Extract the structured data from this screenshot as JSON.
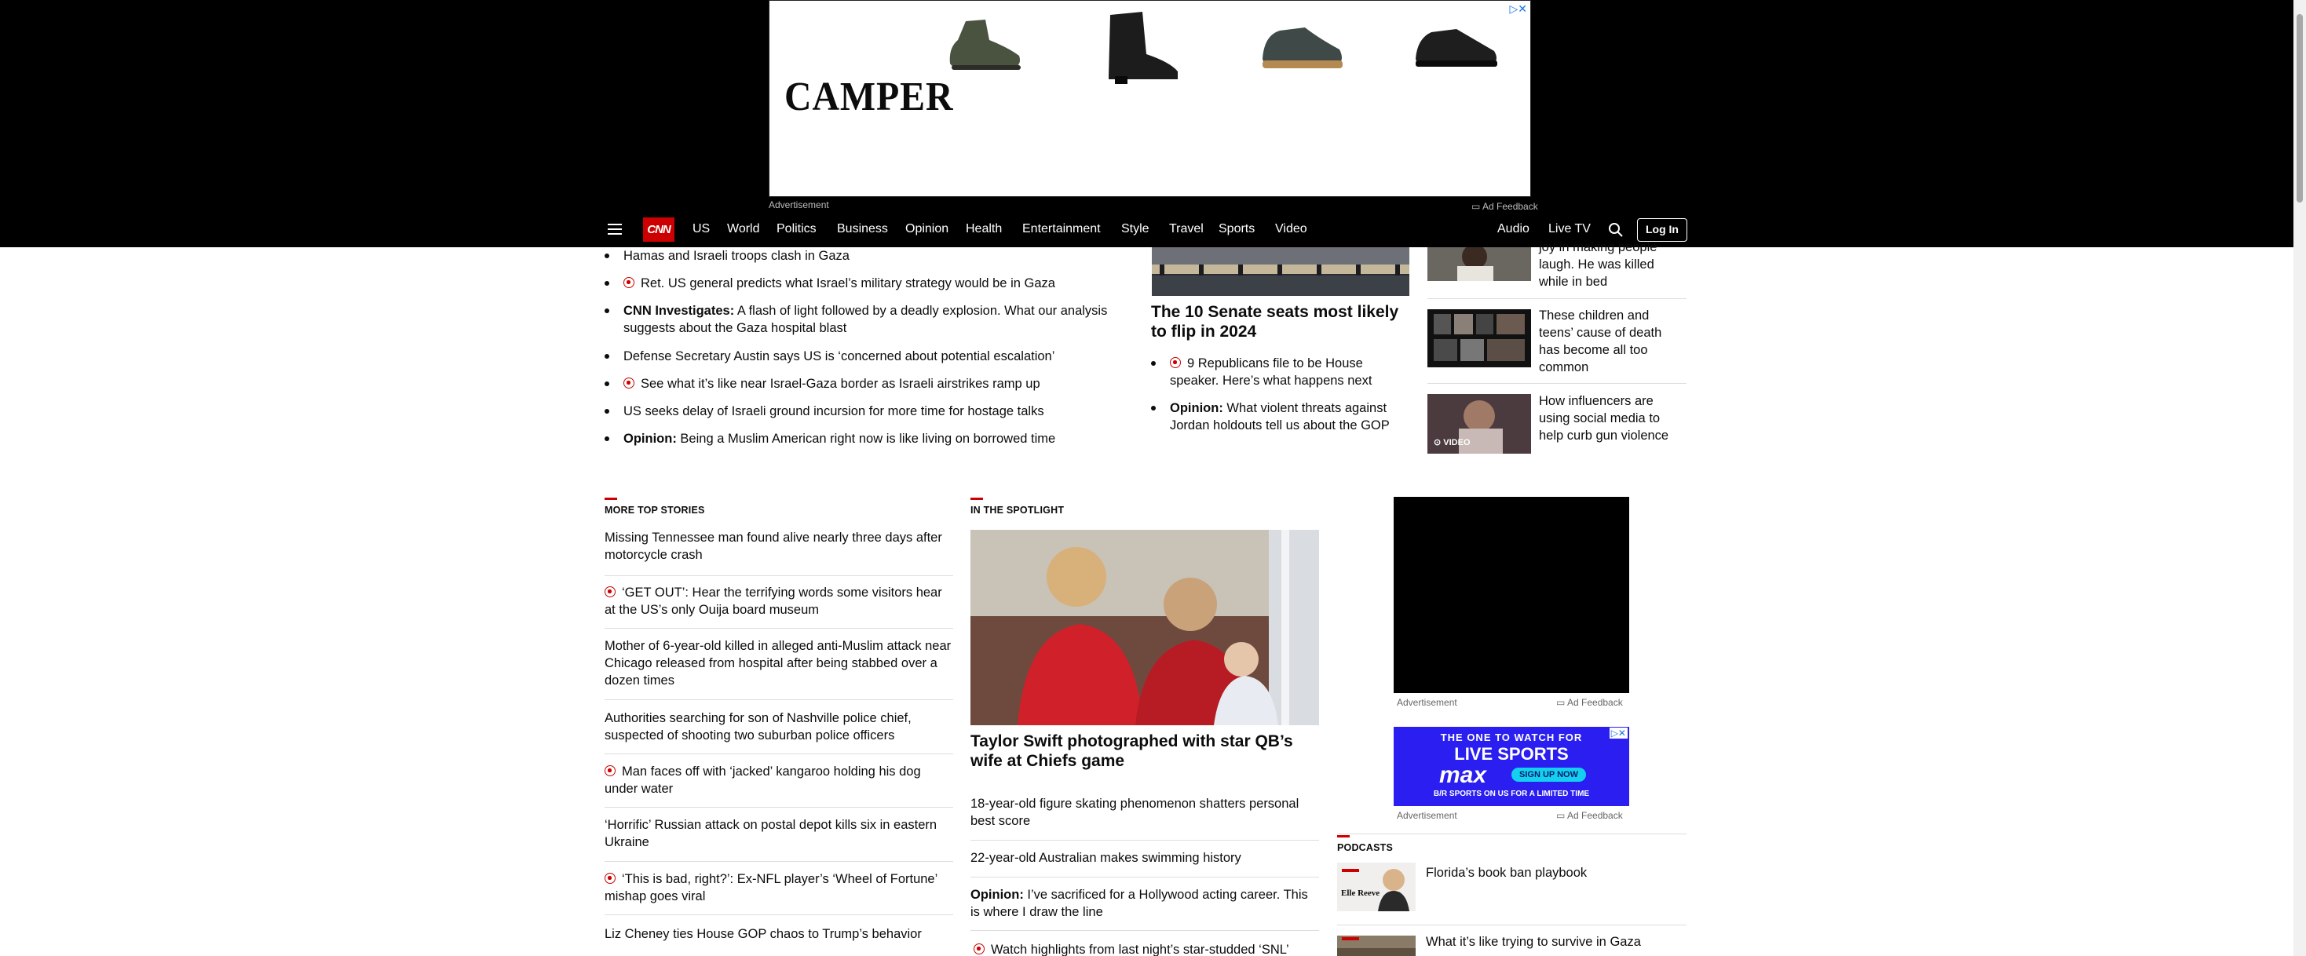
{
  "ad_top": {
    "brand": "CAMPER",
    "label": "Advertisement",
    "feedback": "Ad Feedback",
    "choices_icon": "adchoices-icon"
  },
  "nav": {
    "menu_icon": "hamburger-menu-icon",
    "logo": "CNN",
    "items": [
      "US",
      "World",
      "Politics",
      "Business",
      "Opinion",
      "Health",
      "Entertainment",
      "Style",
      "Travel",
      "Sports",
      "Video"
    ],
    "right_items": [
      "Audio",
      "Live TV"
    ],
    "search_icon": "search-icon",
    "login": "Log In"
  },
  "top_list": [
    {
      "prefix": "",
      "video": false,
      "text": "Hamas and Israeli troops clash in Gaza"
    },
    {
      "prefix": "",
      "video": true,
      "text": "Ret. US general predicts what Israel’s military strategy would be in Gaza"
    },
    {
      "prefix": "CNN Investigates:",
      "video": false,
      "text": "A flash of light followed by a deadly explosion. What our analysis suggests about the Gaza hospital blast"
    },
    {
      "prefix": "",
      "video": false,
      "text": "Defense Secretary Austin says US is ‘concerned about potential escalation’"
    },
    {
      "prefix": "",
      "video": true,
      "text": "See what it’s like near Israel-Gaza border as Israeli airstrikes ramp up"
    },
    {
      "prefix": "",
      "video": false,
      "text": "US seeks delay of Israeli ground incursion for more time for hostage talks"
    },
    {
      "prefix": "Opinion:",
      "video": false,
      "text": "Being a Muslim American right now is like living on borrowed time"
    }
  ],
  "middle": {
    "headline": "The 10 Senate seats most likely to flip in 2024",
    "bullets": [
      {
        "prefix": "",
        "video": true,
        "text": "9 Republicans file to be House speaker. Here’s what happens next"
      },
      {
        "prefix": "Opinion:",
        "video": false,
        "text": "What violent threats against Jordan holdouts tell us about the GOP"
      }
    ]
  },
  "right_stories": [
    {
      "text": "joy in making people laugh. He was killed while in bed",
      "badge": ""
    },
    {
      "text": "These children and teens’ cause of death has become all too common",
      "badge": ""
    },
    {
      "text": "How influencers are using social media to help curb gun violence",
      "badge": "VIDEO"
    }
  ],
  "more_top_stories": {
    "title": "MORE TOP STORIES",
    "items": [
      {
        "video": false,
        "text": "Missing Tennessee man found alive nearly three days after motorcycle crash"
      },
      {
        "video": true,
        "text": "‘GET OUT’: Hear the terrifying words some visitors hear at the US’s only Ouija board museum"
      },
      {
        "video": false,
        "text": "Mother of 6-year-old killed in alleged anti-Muslim attack near Chicago released from hospital after being stabbed over a dozen times"
      },
      {
        "video": false,
        "text": "Authorities searching for son of Nashville police chief, suspected of shooting two suburban police officers"
      },
      {
        "video": true,
        "text": "Man faces off with ‘jacked’ kangaroo holding his dog under water"
      },
      {
        "video": false,
        "text": "‘Horrific’ Russian attack on postal depot kills six in eastern Ukraine"
      },
      {
        "video": true,
        "text": "‘This is bad, right?’: Ex-NFL player’s ‘Wheel of Fortune’ mishap goes viral"
      },
      {
        "video": false,
        "text": "Liz Cheney ties House GOP chaos to Trump’s behavior"
      }
    ]
  },
  "spotlight": {
    "title": "IN THE SPOTLIGHT",
    "headline": "Taylor Swift photographed with star QB’s wife at Chiefs game",
    "items": [
      {
        "prefix": "",
        "video": false,
        "text": "18-year-old figure skating phenomenon shatters personal best score"
      },
      {
        "prefix": "",
        "video": false,
        "text": "22-year-old Australian makes swimming history"
      },
      {
        "prefix": "Opinion:",
        "video": false,
        "text": "I’ve sacrificed for a Hollywood acting career. This is where I draw the line"
      },
      {
        "prefix": "",
        "video": true,
        "text": "Watch highlights from last night’s star-studded ‘SNL’"
      }
    ]
  },
  "side_ads": {
    "label": "Advertisement",
    "feedback": "Ad Feedback",
    "max_ad": {
      "line1": "THE ONE TO WATCH FOR",
      "line2": "LIVE SPORTS",
      "brand": "max",
      "cta": "SIGN UP NOW",
      "line3": "B/R SPORTS ON US FOR A LIMITED TIME"
    }
  },
  "podcasts": {
    "title": "PODCASTS",
    "items": [
      {
        "text": "Florida’s book ban playbook",
        "thumb_caption": "Elle Reeve"
      },
      {
        "text": "What it’s like trying to survive in Gaza",
        "thumb_caption": ""
      }
    ]
  },
  "colors": {
    "accent": "#cc0000",
    "black": "#000000",
    "max_blue": "#2a1ff0"
  }
}
